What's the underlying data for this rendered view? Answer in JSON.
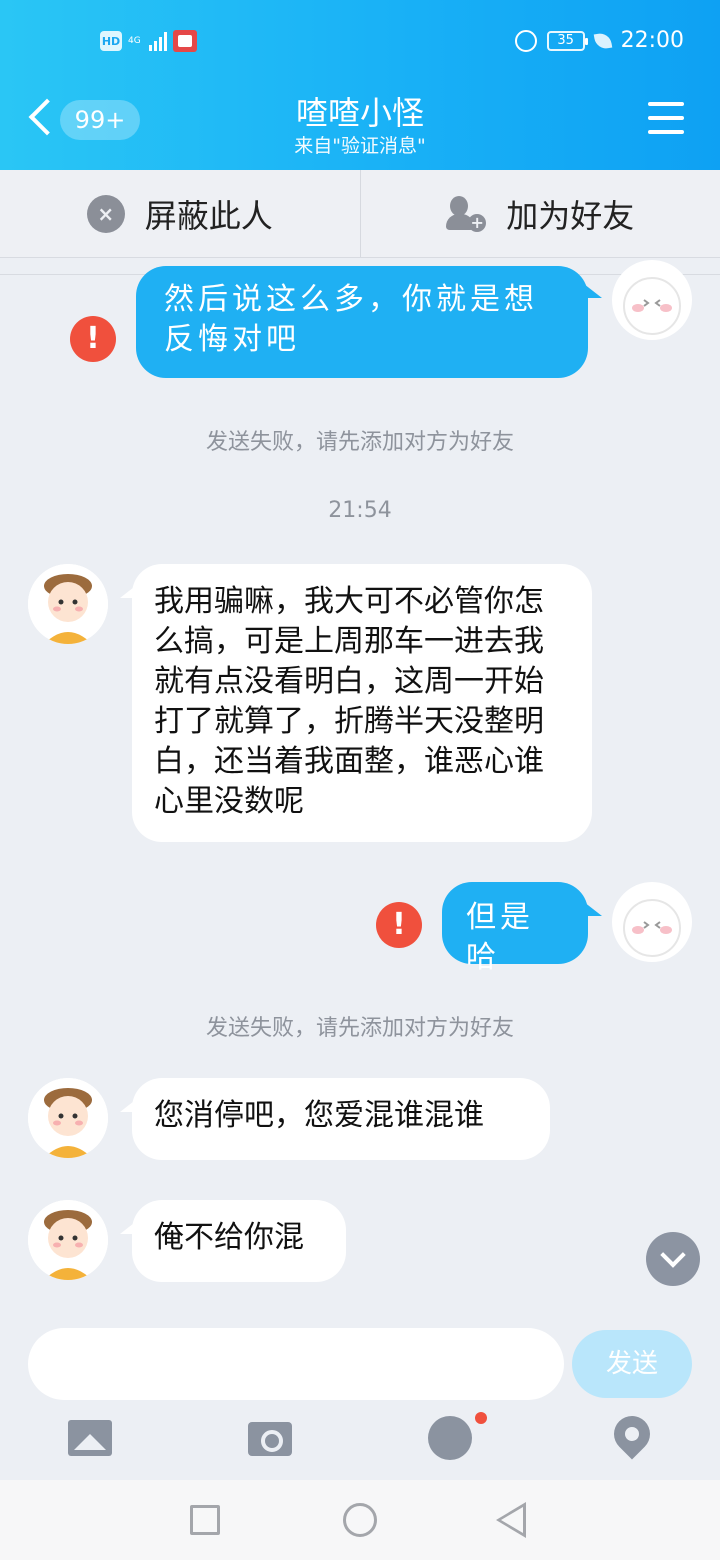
{
  "status_bar": {
    "hd": "HD",
    "network": "4G",
    "battery": "35",
    "time": "22:00"
  },
  "header": {
    "unread_badge": "99+",
    "title": "喳喳小怪",
    "subtitle": "来自\"验证消息\""
  },
  "actions": {
    "block_label": "屏蔽此人",
    "add_friend_label": "加为好友"
  },
  "messages": {
    "m1_text": "然后说这么多，你就是想反悔对吧",
    "system_fail_1": "发送失败，请先添加对方为好友",
    "timestamp": "21:54",
    "m2_text": "我用骗嘛，我大可不必管你怎么搞，可是上周那车一进去我就有点没看明白，这周一开始打了就算了，折腾半天没整明白，还当着我面整，谁恶心谁心里没数呢",
    "m3_text": "但是哈",
    "system_fail_2": "发送失败，请先添加对方为好友",
    "m4_text": "您消停吧，您爱混谁混谁",
    "m5_text": "俺不给你混"
  },
  "composer": {
    "input_value": "",
    "send_label": "发送"
  },
  "colors": {
    "header_gradient_start": "#2ac6f5",
    "header_gradient_end": "#0ea1f3",
    "outgoing_bubble": "#1fb0f3",
    "error_red": "#f0503d",
    "chat_background": "#eceff4"
  },
  "icons": {
    "back": "chevron-left-icon",
    "menu": "hamburger-menu-icon",
    "block": "block-face-icon",
    "add_friend": "add-user-icon",
    "error": "exclamation-icon",
    "scroll_down": "chevron-down-icon",
    "toolbar": [
      "image-icon",
      "camera-icon",
      "emoji-icon",
      "location-icon"
    ],
    "nav": [
      "recent-apps-icon",
      "home-icon",
      "back-triangle-icon"
    ]
  }
}
